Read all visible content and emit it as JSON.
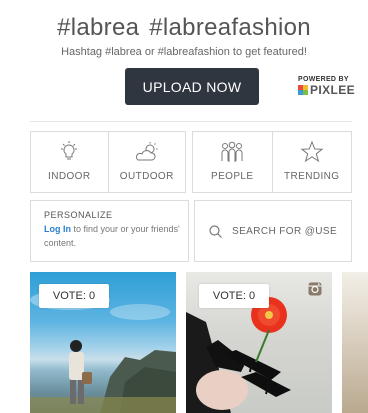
{
  "header": {
    "hashtag_1": "#labrea",
    "hashtag_2": "#labreafashion",
    "subtitle": "Hashtag #labrea or #labreafashion to get featured!",
    "upload_label": "UPLOAD NOW",
    "powered_by": "POWERED BY",
    "brand": "PIXLEE"
  },
  "filters": [
    {
      "label": "INDOOR",
      "icon": "lightbulb-icon"
    },
    {
      "label": "OUTDOOR",
      "icon": "sun-cloud-icon"
    },
    {
      "label": "PEOPLE",
      "icon": "people-icon"
    },
    {
      "label": "TRENDING",
      "icon": "star-icon"
    }
  ],
  "personalize": {
    "title": "PERSONALIZE",
    "login_text": "Log In",
    "desc_rest": " to find your or your friends' content."
  },
  "search": {
    "placeholder": "SEARCH FOR @USE",
    "icon": "search-icon"
  },
  "gallery": {
    "cards": [
      {
        "vote_label": "VOTE: 0",
        "scene": "man on coastal cliff under blue sky"
      },
      {
        "vote_label": "VOTE: 0",
        "scene": "black heels with red flower on pavement",
        "badge_icon": "instagram-icon"
      },
      {
        "scene": "partially visible photo"
      }
    ]
  },
  "colors": {
    "button_bg": "#2f3640",
    "link": "#2a7fcf",
    "border": "#dcdcdc"
  }
}
